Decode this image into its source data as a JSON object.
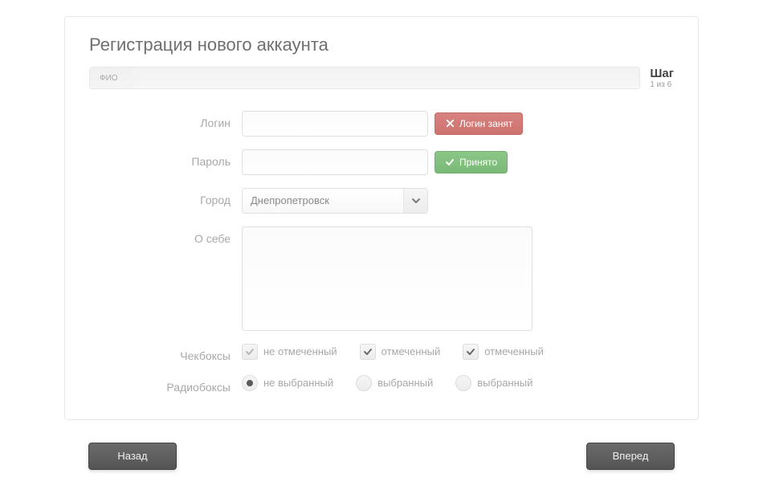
{
  "title": "Регистрация нового аккаунта",
  "progress": {
    "tag": "ФИО",
    "label": "Шаг",
    "sub": "1 из 6"
  },
  "fields": {
    "login": {
      "label": "Логин",
      "value": "",
      "status": "Логин занят"
    },
    "password": {
      "label": "Пароль",
      "value": "",
      "status": "Принято"
    },
    "city": {
      "label": "Город",
      "selected": "Днепропетровск"
    },
    "about": {
      "label": "О себе",
      "value": ""
    },
    "checks": {
      "label": "Чекбоксы",
      "item1": "не отмеченный",
      "item2": "отмеченный",
      "item3": "отмеченный"
    },
    "radios": {
      "label": "Радиобоксы",
      "item1": "не выбранный",
      "item2": "выбранный",
      "item3": "выбранный"
    }
  },
  "buttons": {
    "back": "Назад",
    "forward": "Вперед"
  }
}
